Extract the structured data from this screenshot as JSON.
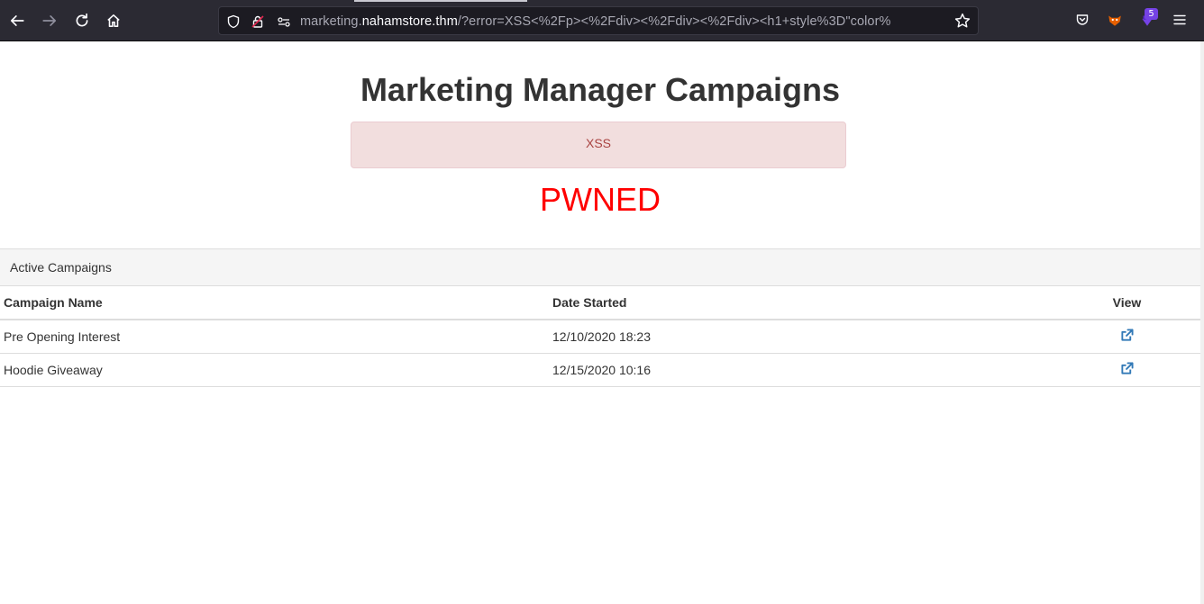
{
  "browser": {
    "url_prefix": "marketing.",
    "url_host": "nahamstore.thm",
    "url_rest": "/?error=XSS<%2Fp><%2Fdiv><%2Fdiv><%2Fdiv><h1+style%3D\"color%",
    "extensions_badge": "5",
    "icons": [
      "back-icon",
      "forward-icon",
      "reload-icon",
      "home-icon",
      "shield-icon",
      "lock-icon",
      "permissions-icon",
      "star-icon",
      "pocket-icon",
      "extension-icon",
      "menu-icon"
    ]
  },
  "page": {
    "title": "Marketing Manager Campaigns",
    "alert_text": "XSS",
    "injected_heading": "PWNED",
    "injected_color": "#ff0000",
    "panel_heading": "Active Campaigns",
    "table": {
      "headers": [
        "Campaign Name",
        "Date Started",
        "View"
      ],
      "rows": [
        {
          "name": "Pre Opening Interest",
          "date": "12/10/2020 18:23"
        },
        {
          "name": "Hoodie Giveaway",
          "date": "12/15/2020 10:16"
        }
      ]
    },
    "link_color": "#337ab7"
  }
}
